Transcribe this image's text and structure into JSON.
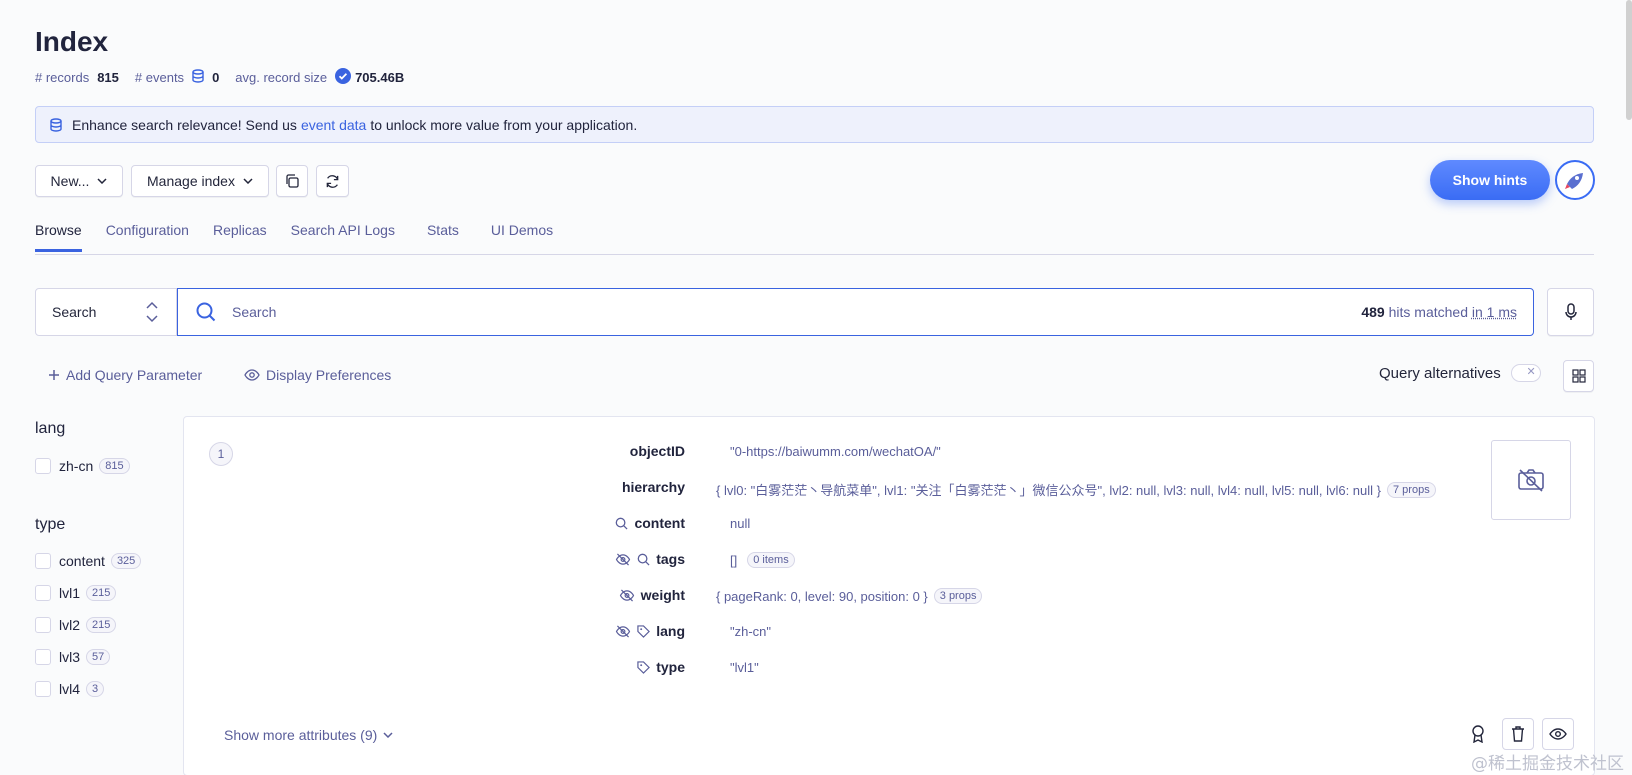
{
  "header": {
    "title": "Index",
    "records_label": "# records",
    "records_value": "815",
    "events_label": "# events",
    "events_value": "0",
    "avg_label": "avg. record size",
    "avg_value": "705.46B"
  },
  "banner": {
    "text_before": "Enhance search relevance! Send us",
    "link": "event data",
    "text_after": "to unlock more value from your application."
  },
  "toolbar": {
    "new_label": "New...",
    "manage_label": "Manage index",
    "hints_label": "Show hints"
  },
  "tabs": [
    "Browse",
    "Configuration",
    "Replicas",
    "Search API Logs",
    "Stats",
    "UI Demos"
  ],
  "search": {
    "mode": "Search",
    "placeholder": "Search",
    "hits_count": "489",
    "hits_text": "hits matched",
    "time_text": "in 1 ms"
  },
  "options": {
    "add_param": "Add Query Parameter",
    "display_prefs": "Display Preferences",
    "query_alternatives": "Query alternatives"
  },
  "facets": {
    "lang": {
      "title": "lang",
      "items": [
        {
          "label": "zh-cn",
          "count": "815"
        }
      ]
    },
    "type": {
      "title": "type",
      "items": [
        {
          "label": "content",
          "count": "325"
        },
        {
          "label": "lvl1",
          "count": "215"
        },
        {
          "label": "lvl2",
          "count": "215"
        },
        {
          "label": "lvl3",
          "count": "57"
        },
        {
          "label": "lvl4",
          "count": "3"
        }
      ]
    }
  },
  "record": {
    "rank": "1",
    "attributes": [
      {
        "key": "objectID",
        "value": "\"0-https://baiwumm.com/wechatOA/\"",
        "pill": ""
      },
      {
        "key": "hierarchy",
        "value": "{ lvl0: \"白雾茫茫丶导航菜单\", lvl1: \"关注「白雾茫茫丶」微信公众号\", lvl2: null, lvl3: null, lvl4: null, lvl5: null, lvl6: null }",
        "pill": "7 props"
      },
      {
        "key": "content",
        "value": "null",
        "pill": ""
      },
      {
        "key": "tags",
        "value": "[]",
        "pill": "0 items"
      },
      {
        "key": "weight",
        "value": "{ pageRank: 0, level: 90, position: 0 }",
        "pill": "3 props"
      },
      {
        "key": "lang",
        "value": "\"zh-cn\"",
        "pill": ""
      },
      {
        "key": "type",
        "value": "\"lvl1\"",
        "pill": ""
      }
    ],
    "show_more": "Show more attributes (9)"
  },
  "watermark": "@稀土掘金技术社区",
  "colors": {
    "accent": "#3a63e0",
    "hints_button": "#3a6cf4",
    "banner_bg": "#eef1fc"
  }
}
